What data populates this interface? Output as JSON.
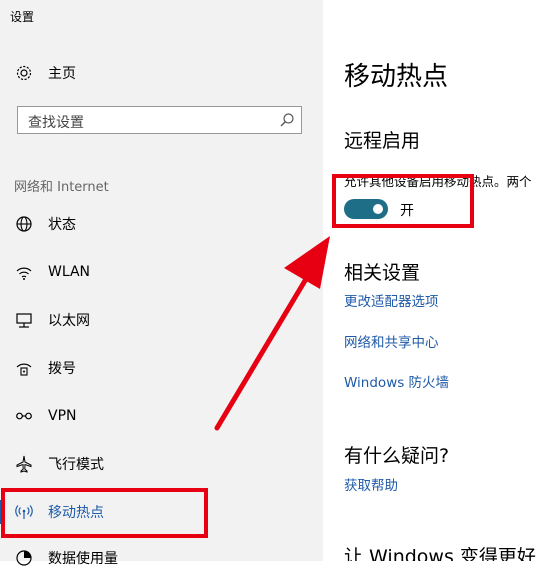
{
  "window": {
    "title": "设置"
  },
  "sidebar": {
    "home_label": "主页",
    "search_placeholder": "查找设置",
    "section_header": "网络和 Internet",
    "items": [
      {
        "label": "状态",
        "icon": "globe-icon"
      },
      {
        "label": "WLAN",
        "icon": "wifi-icon"
      },
      {
        "label": "以太网",
        "icon": "ethernet-icon"
      },
      {
        "label": "拨号",
        "icon": "dialup-icon"
      },
      {
        "label": "VPN",
        "icon": "vpn-icon"
      },
      {
        "label": "飞行模式",
        "icon": "airplane-icon"
      },
      {
        "label": "移动热点",
        "icon": "hotspot-icon",
        "active": true
      },
      {
        "label": "数据使用量",
        "icon": "data-usage-icon"
      }
    ]
  },
  "main": {
    "title": "移动热点",
    "remote_section_title": "远程启用",
    "remote_description": "允许其他设备启用移动热点。两个",
    "toggle_state_label": "开",
    "toggle_on": true,
    "related_title": "相关设置",
    "related_links": [
      "更改适配器选项",
      "网络和共享中心",
      "Windows 防火墙"
    ],
    "question_title": "有什么疑问?",
    "help_link": "获取帮助",
    "feedback_title": "让 Windows 变得更好"
  },
  "colors": {
    "accent": "#1f5aa8",
    "toggle_on": "#1d6e86",
    "annotation_red": "#e60012",
    "sidebar_bg": "#f2f2f2"
  }
}
